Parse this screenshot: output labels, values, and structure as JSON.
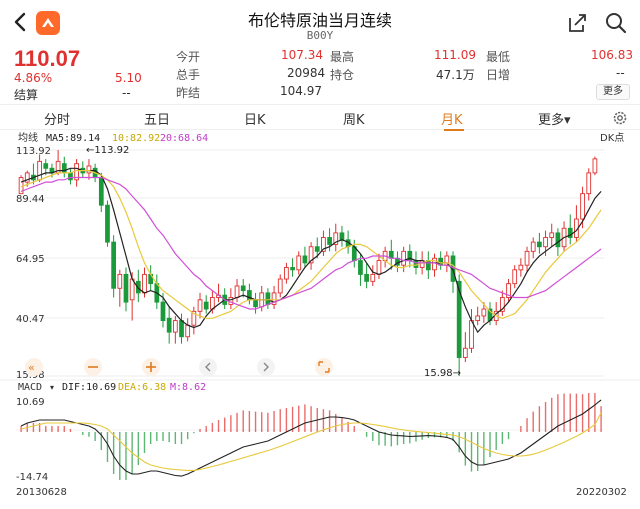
{
  "header": {
    "title": "布伦特原油当月连续",
    "code": "B00Y"
  },
  "quote": {
    "last_price": "110.07",
    "change_pct": "4.86%",
    "change": "5.10",
    "settle_label": "结算",
    "settle_value": "--",
    "fields": [
      {
        "label": "今开",
        "value": "107.34"
      },
      {
        "label": "最高",
        "value": "111.09"
      },
      {
        "label": "最低",
        "value": "106.83"
      },
      {
        "label": "总手",
        "value": "20984"
      },
      {
        "label": "持仓",
        "value": "47.1万"
      },
      {
        "label": "日增",
        "value": "--"
      },
      {
        "label": "昨结",
        "value": "104.97"
      }
    ],
    "more_label": "更多"
  },
  "periods": {
    "tabs": [
      "分时",
      "五日",
      "日K",
      "周K",
      "月K",
      "更多▾"
    ],
    "active": "月K"
  },
  "colors": {
    "up": "#e0302f",
    "down": "#1a9a3a",
    "ma5": "#222222",
    "ma10": "#e8c93a",
    "ma20": "#d04fd6",
    "accent": "#e07a1f"
  },
  "kchart": {
    "indicator_label": "均线",
    "ma5": "MA5:89.14",
    "ma10": "10:82.92",
    "ma20": "20:68.64",
    "dk_label": "DK点",
    "y_ticks": [
      "113.92",
      "89.44",
      "64.95",
      "40.47",
      "15.98"
    ],
    "max_annotation": "←113.92",
    "min_annotation": "15.98→",
    "toolbar_icons": [
      "collapse-icon",
      "zoom-out-icon",
      "zoom-in-icon",
      "scroll-left-icon",
      "scroll-right-icon",
      "fullscreen-icon"
    ]
  },
  "macd": {
    "label": "MACD",
    "dif": "DIF:10.69",
    "dea": "DEA:6.38",
    "m": "M:8.62",
    "y_top": "10.69",
    "y_bottom": "-14.74",
    "date_start": "20130628",
    "date_end": "20220302"
  },
  "chart_data": {
    "type": "candlestick",
    "ylim": [
      15.98,
      113.92
    ],
    "candles": [
      [
        95,
        102,
        103,
        97
      ],
      [
        100,
        104,
        105,
        98
      ],
      [
        103,
        101,
        108,
        99
      ],
      [
        101,
        109,
        112,
        100
      ],
      [
        108,
        106,
        110,
        103
      ],
      [
        106,
        104,
        108,
        102
      ],
      [
        104,
        109,
        113.9,
        103
      ],
      [
        108,
        104,
        111,
        102
      ],
      [
        104,
        101,
        106,
        99
      ],
      [
        101,
        108,
        110,
        98
      ],
      [
        106,
        104,
        109,
        102
      ],
      [
        104,
        107,
        110,
        101
      ],
      [
        106,
        102,
        108,
        100
      ],
      [
        102,
        90,
        104,
        87
      ],
      [
        90,
        74,
        92,
        72
      ],
      [
        74,
        54,
        77,
        50
      ],
      [
        54,
        60,
        62,
        46
      ],
      [
        60,
        48,
        63,
        44
      ],
      [
        49,
        58,
        61,
        40
      ],
      [
        57,
        52,
        62,
        48
      ],
      [
        52,
        60,
        63,
        50
      ],
      [
        60,
        56,
        64,
        53
      ],
      [
        56,
        48,
        60,
        45
      ],
      [
        48,
        40,
        52,
        37
      ],
      [
        41,
        35,
        46,
        30
      ],
      [
        35,
        40,
        42,
        30
      ],
      [
        40,
        33,
        43,
        30
      ],
      [
        33,
        38,
        41,
        31
      ],
      [
        38,
        44,
        46,
        34
      ],
      [
        44,
        49,
        52,
        41
      ],
      [
        48,
        45,
        51,
        43
      ],
      [
        45,
        50,
        53,
        43
      ],
      [
        50,
        51,
        56,
        48
      ],
      [
        51,
        47,
        54,
        45
      ],
      [
        47,
        50,
        54,
        45
      ],
      [
        50,
        55,
        58,
        48
      ],
      [
        55,
        53,
        58,
        50
      ],
      [
        53,
        49,
        56,
        47
      ],
      [
        49,
        46,
        52,
        43
      ],
      [
        46,
        52,
        55,
        44
      ],
      [
        52,
        47,
        54,
        45
      ],
      [
        47,
        52,
        55,
        45
      ],
      [
        52,
        58,
        60,
        50
      ],
      [
        58,
        63,
        65,
        56
      ],
      [
        63,
        62,
        67,
        59
      ],
      [
        62,
        68,
        70,
        60
      ],
      [
        68,
        65,
        72,
        63
      ],
      [
        65,
        72,
        74,
        62
      ],
      [
        72,
        70,
        76,
        67
      ],
      [
        70,
        76,
        79,
        68
      ],
      [
        76,
        73,
        80,
        70
      ],
      [
        73,
        78,
        82,
        70
      ],
      [
        78,
        75,
        81,
        72
      ],
      [
        75,
        72,
        79,
        69
      ],
      [
        72,
        66,
        75,
        63
      ],
      [
        66,
        60,
        69,
        55
      ],
      [
        60,
        57,
        65,
        54
      ],
      [
        57,
        60,
        64,
        55
      ],
      [
        60,
        66,
        69,
        58
      ],
      [
        66,
        70,
        72,
        63
      ],
      [
        70,
        67,
        75,
        62
      ],
      [
        67,
        64,
        70,
        61
      ],
      [
        64,
        70,
        72,
        61
      ],
      [
        70,
        66,
        73,
        63
      ],
      [
        66,
        63,
        70,
        60
      ],
      [
        63,
        66,
        70,
        60
      ],
      [
        66,
        62,
        70,
        58
      ],
      [
        62,
        67,
        69,
        59
      ],
      [
        67,
        64,
        70,
        62
      ],
      [
        64,
        68,
        70,
        61
      ],
      [
        68,
        57,
        70,
        52
      ],
      [
        57,
        24,
        60,
        15.98
      ],
      [
        24,
        28,
        35,
        22
      ],
      [
        28,
        40,
        45,
        26
      ],
      [
        40,
        42,
        46,
        38
      ],
      [
        42,
        45,
        48,
        39
      ],
      [
        45,
        40,
        48,
        38
      ],
      [
        40,
        44,
        48,
        38
      ],
      [
        44,
        50,
        53,
        42
      ],
      [
        50,
        56,
        58,
        48
      ],
      [
        56,
        62,
        64,
        54
      ],
      [
        62,
        64,
        67,
        59
      ],
      [
        64,
        70,
        72,
        61
      ],
      [
        70,
        74,
        76,
        67
      ],
      [
        74,
        72,
        78,
        69
      ],
      [
        72,
        76,
        79,
        68
      ],
      [
        76,
        78,
        82,
        72
      ],
      [
        78,
        72,
        80,
        68
      ],
      [
        72,
        80,
        83,
        70
      ],
      [
        80,
        76,
        86,
        73
      ],
      [
        76,
        84,
        90,
        74
      ],
      [
        84,
        95,
        98,
        80
      ],
      [
        95,
        104,
        106,
        92
      ],
      [
        104,
        110.07,
        111.09,
        103
      ]
    ],
    "ma5": [
      100,
      101,
      102,
      103,
      104,
      104,
      105,
      105,
      106,
      106,
      105,
      105,
      105,
      103,
      97,
      88,
      78,
      68,
      58,
      54,
      52,
      53,
      52,
      50,
      46,
      43,
      40,
      38,
      37,
      38,
      42,
      45,
      47,
      49,
      49,
      50,
      51,
      50,
      49,
      49,
      49,
      48,
      49,
      51,
      55,
      59,
      63,
      66,
      68,
      71,
      72,
      74,
      75,
      74,
      72,
      69,
      65,
      61,
      60,
      61,
      63,
      65,
      66,
      67,
      66,
      66,
      65,
      65,
      65,
      65,
      62,
      53,
      46,
      40,
      35,
      38,
      40,
      43,
      45,
      48,
      52,
      56,
      61,
      65,
      68,
      70,
      72,
      74,
      76,
      77,
      79,
      83,
      88,
      93,
      96
    ],
    "ma10": [
      98,
      99,
      100,
      101,
      102,
      103,
      104,
      104,
      104,
      105,
      105,
      105,
      104,
      103,
      101,
      98,
      93,
      87,
      80,
      72,
      65,
      60,
      56,
      53,
      51,
      49,
      47,
      45,
      43,
      42,
      41,
      41,
      42,
      43,
      44,
      46,
      48,
      49,
      49,
      49,
      49,
      49,
      49,
      50,
      51,
      53,
      55,
      57,
      60,
      63,
      66,
      69,
      71,
      72,
      73,
      73,
      72,
      70,
      68,
      66,
      64,
      63,
      63,
      64,
      64,
      65,
      66,
      66,
      65,
      65,
      64,
      61,
      57,
      53,
      50,
      47,
      44,
      42,
      41,
      42,
      43,
      46,
      49,
      53,
      57,
      61,
      64,
      67,
      70,
      72,
      74,
      77,
      80,
      84,
      88
    ],
    "ma20": [
      96,
      97,
      98,
      99,
      100,
      100,
      101,
      101,
      102,
      102,
      102,
      102,
      102,
      102,
      101,
      100,
      99,
      97,
      94,
      91,
      88,
      84,
      80,
      77,
      73,
      69,
      66,
      63,
      60,
      58,
      55,
      53,
      51,
      49,
      48,
      47,
      46,
      45,
      45,
      46,
      47,
      48,
      49,
      50,
      51,
      52,
      53,
      54,
      56,
      58,
      60,
      62,
      63,
      65,
      66,
      67,
      67,
      68,
      68,
      68,
      67,
      67,
      66,
      66,
      65,
      65,
      65,
      65,
      64,
      64,
      63,
      62,
      61,
      60,
      58,
      56,
      54,
      53,
      52,
      51,
      50,
      50,
      50,
      51,
      52,
      53,
      55,
      57,
      59,
      61,
      63,
      65,
      67,
      69,
      71
    ],
    "macd_dif": [
      2,
      3,
      3.5,
      4,
      4,
      4,
      4,
      4,
      3.5,
      3,
      2.5,
      2,
      1,
      -1,
      -4,
      -8,
      -11,
      -13,
      -14,
      -14,
      -13.5,
      -13,
      -13,
      -13.5,
      -14,
      -14.5,
      -14.7,
      -14,
      -13,
      -12,
      -11,
      -10,
      -9,
      -8,
      -7,
      -6,
      -5,
      -4.5,
      -4,
      -3.5,
      -3,
      -2,
      -1,
      0,
      1,
      2,
      3,
      3.5,
      4,
      4.5,
      5,
      5,
      4.8,
      4.5,
      4,
      3,
      2,
      1,
      0,
      -0.5,
      -1,
      -1.2,
      -1.3,
      -1.5,
      -1.4,
      -1.3,
      -1.2,
      -1.3,
      -1.5,
      -1.8,
      -2.5,
      -5,
      -8,
      -10,
      -11,
      -11,
      -10.5,
      -10,
      -9.5,
      -9,
      -8,
      -7,
      -5.5,
      -4,
      -2.5,
      -1,
      0.5,
      2,
      3,
      4,
      5,
      6,
      7.5,
      9,
      10.69
    ],
    "macd_dea": [
      1,
      1.5,
      2,
      2.5,
      3,
      3,
      3,
      3,
      3,
      3,
      3,
      2.8,
      2.5,
      2,
      1,
      -1,
      -3,
      -5,
      -7,
      -8.5,
      -10,
      -11,
      -11.5,
      -12,
      -12.3,
      -12.5,
      -12.7,
      -12.8,
      -12.8,
      -12.5,
      -12,
      -11.5,
      -11,
      -10.4,
      -9.8,
      -9.2,
      -8.6,
      -8,
      -7.4,
      -6.8,
      -6.2,
      -5.5,
      -4.8,
      -4,
      -3.2,
      -2.4,
      -1.6,
      -0.8,
      0,
      0.7,
      1.4,
      2,
      2.5,
      2.8,
      3,
      3,
      2.8,
      2.5,
      2.2,
      1.8,
      1.4,
      1,
      0.7,
      0.4,
      0.2,
      0,
      -0.2,
      -0.4,
      -0.6,
      -0.8,
      -1,
      -1.6,
      -2.4,
      -3.4,
      -4.5,
      -5.5,
      -6.3,
      -7,
      -7.5,
      -7.8,
      -8,
      -8,
      -7.8,
      -7.4,
      -6.8,
      -6,
      -5.2,
      -4.3,
      -3.4,
      -2.4,
      -1.4,
      -0.3,
      1,
      2.5,
      6.38
    ]
  }
}
